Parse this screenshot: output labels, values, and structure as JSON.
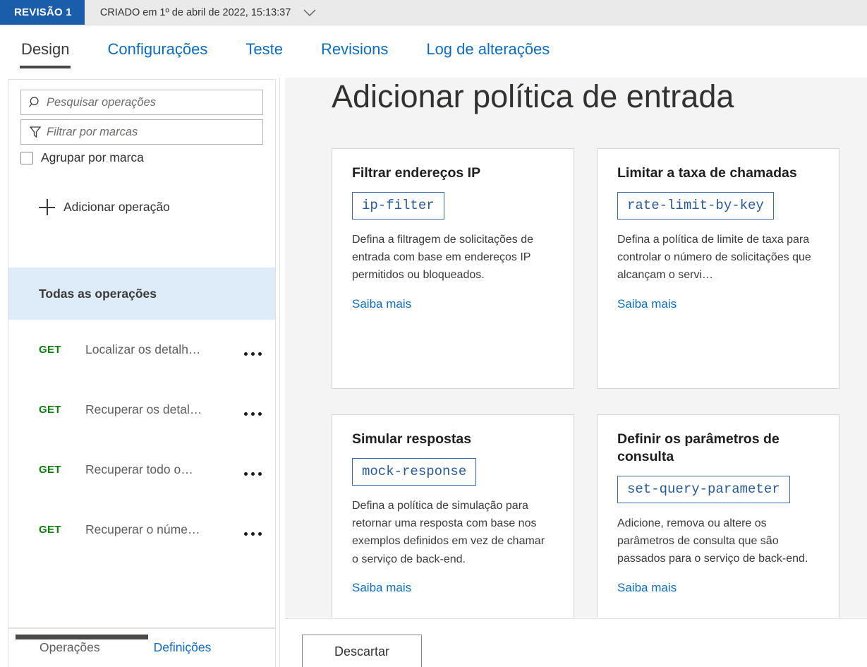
{
  "revision_bar": {
    "badge": "REVISÃO 1",
    "meta": "CRIADO em 1º de abril de 2022, 15:13:37",
    "chevron_icon": "chevron-down-icon"
  },
  "tabs": [
    {
      "label": "Design",
      "active": true
    },
    {
      "label": "Configurações",
      "active": false
    },
    {
      "label": "Teste",
      "active": false
    },
    {
      "label": "Revisions",
      "active": false
    },
    {
      "label": "Log de alterações",
      "active": false
    }
  ],
  "sidebar": {
    "search": {
      "placeholder": "Pesquisar operações",
      "value": "",
      "icon": "search-icon"
    },
    "filter": {
      "placeholder": "Filtrar por marcas",
      "value": "",
      "icon": "funnel-icon"
    },
    "group_checkbox": {
      "label": "Agrupar por marca",
      "checked": false
    },
    "add_operation": {
      "label": "Adicionar operação",
      "icon": "plus-icon"
    },
    "all_operations": {
      "label": "Todas as operações",
      "selected": true
    },
    "operations": [
      {
        "verb": "GET",
        "name": "Localizar os detalh…",
        "menu": "ellipsis-icon"
      },
      {
        "verb": "GET",
        "name": "Recuperar os detal…",
        "menu": "ellipsis-icon"
      },
      {
        "verb": "GET",
        "name": "Recuperar todo o…",
        "menu": "ellipsis-icon"
      },
      {
        "verb": "GET",
        "name": "Recuperar o núme…",
        "menu": "ellipsis-icon"
      }
    ],
    "footer_tabs": [
      {
        "label": "Operações",
        "active": true
      },
      {
        "label": "Definições",
        "active": false
      }
    ],
    "scrollbar": "horizontal-scrollbar"
  },
  "main": {
    "title": "Adicionar política de entrada",
    "cards": [
      {
        "title": "Filtrar endereços IP",
        "code": "ip-filter",
        "description": "Defina a filtragem de solicitações de entrada com base em endereços IP permitidos ou bloqueados.",
        "link": "Saiba mais"
      },
      {
        "title": "Limitar a taxa de chamadas",
        "code": "rate-limit-by-key",
        "description": "Defina a política de limite de taxa para controlar o número de solicitações que alcançam o servi…",
        "link": "Saiba mais"
      },
      {
        "title": "Simular respostas",
        "code": "mock-response",
        "description": "Defina a política de simulação para retornar uma resposta com base nos exemplos definidos em vez de chamar o serviço de back-end.",
        "link": "Saiba mais"
      },
      {
        "title": "Definir os parâmetros de consulta",
        "code": "set-query-parameter",
        "description": "Adicione, remova ou altere os parâmetros de consulta que são passados para o serviço de back-end.",
        "link": "Saiba mais"
      }
    ]
  },
  "action_bar": {
    "discard_label": "Descartar"
  },
  "colors": {
    "badge_blue": "#1a5da8",
    "link_blue": "#0f6cbd",
    "verb_green": "#107c10",
    "selection_blue": "#deecf9",
    "code_blue": "#2a5a96",
    "content_bg": "#f4f4f4"
  }
}
